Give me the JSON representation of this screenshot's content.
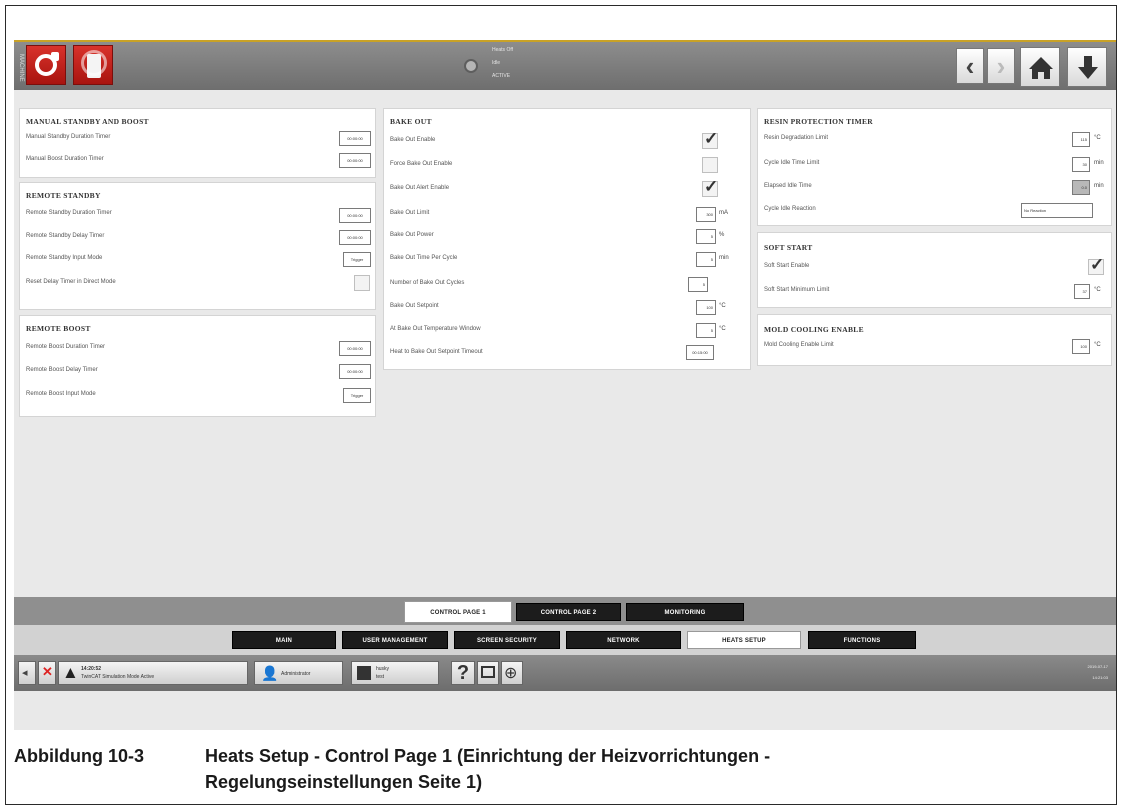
{
  "top_bar": {
    "side_tag": "MACHINE",
    "status_lines": [
      "Heats Off",
      "Idle",
      "ACTIVE"
    ],
    "prev_icon": "chevron-left-icon",
    "next_icon": "chevron-right-icon",
    "home_icon": "home-icon",
    "download_icon": "download-icon"
  },
  "manual_standby_boost": {
    "title": "MANUAL STANDBY AND BOOST",
    "rows": [
      {
        "label": "Manual Standby Duration Timer",
        "value": "00:00:00"
      },
      {
        "label": "Manual Boost Duration Timer",
        "value": "00:00:00"
      }
    ]
  },
  "remote_standby": {
    "title": "REMOTE STANDBY",
    "rows": [
      {
        "label": "Remote Standby Duration Timer",
        "value": "00:00:00"
      },
      {
        "label": "Remote Standby Delay Timer",
        "value": "00:00:00"
      },
      {
        "label": "Remote Standby Input Mode",
        "value": "Trigger"
      },
      {
        "label": "Reset Delay Timer in Direct Mode",
        "checked": false
      }
    ]
  },
  "remote_boost": {
    "title": "REMOTE BOOST",
    "rows": [
      {
        "label": "Remote Boost Duration Timer",
        "value": "00:00:00"
      },
      {
        "label": "Remote Boost Delay Timer",
        "value": "00:00:00"
      },
      {
        "label": "Remote Boost Input Mode",
        "value": "Trigger"
      }
    ]
  },
  "bake_out": {
    "title": "BAKE OUT",
    "rows": [
      {
        "label": "Bake Out Enable",
        "checked": true
      },
      {
        "label": "Force Bake Out Enable",
        "checked": false
      },
      {
        "label": "Bake Out Alert Enable",
        "checked": true
      },
      {
        "label": "Bake Out Limit",
        "value": "300",
        "unit": "mA"
      },
      {
        "label": "Bake Out Power",
        "value": "5",
        "unit": "%"
      },
      {
        "label": "Bake Out Time Per Cycle",
        "value": "5",
        "unit": "min"
      },
      {
        "label": "Number of Bake Out Cycles",
        "value": "5",
        "unit": ""
      },
      {
        "label": "Bake Out Setpoint",
        "value": "100",
        "unit": "°C"
      },
      {
        "label": "At Bake Out Temperature Window",
        "value": "5",
        "unit": "°C"
      },
      {
        "label": "Heat to Bake Out Setpoint Timeout",
        "value": "00:15:00",
        "unit": ""
      }
    ]
  },
  "resin_protection": {
    "title": "RESIN PROTECTION TIMER",
    "rows": [
      {
        "label": "Resin Degradation Limit",
        "value": "115",
        "unit": "°C"
      },
      {
        "label": "Cycle Idle Time Limit",
        "value": "30",
        "unit": "min"
      },
      {
        "label": "Elapsed Idle Time",
        "value": "0.0",
        "unit": "min"
      },
      {
        "label": "Cycle Idle Reaction",
        "value": "No Reaction",
        "unit": ""
      }
    ]
  },
  "soft_start": {
    "title": "SOFT START",
    "rows": [
      {
        "label": "Soft Start Enable",
        "checked": true
      },
      {
        "label": "Soft Start Minimum Limit",
        "value": "37",
        "unit": "°C"
      }
    ]
  },
  "mold_cooling": {
    "title": "MOLD COOLING ENABLE",
    "rows": [
      {
        "label": "Mold Cooling Enable Limit",
        "value": "100",
        "unit": "°C"
      }
    ]
  },
  "sub_tabs": [
    "CONTROL PAGE 1",
    "CONTROL PAGE 2",
    "MONITORING"
  ],
  "main_tabs": [
    "MAIN",
    "USER MANAGEMENT",
    "SCREEN SECURITY",
    "NETWORK",
    "HEATS SETUP",
    "FUNCTIONS"
  ],
  "status_bar": {
    "alarm_time": "14:20:52",
    "alarm_text": "TwinCAT Simulation Mode Active",
    "user_text": "Administrator",
    "mold_name": "husky",
    "mold_sub": "test",
    "help_glyph": "?",
    "date": "2019-07-17",
    "time": "14:21:03"
  },
  "caption": {
    "number": "Abbildung 10-3",
    "line1": "Heats Setup - Control Page 1 (Einrichtung der Heizvorrichtungen -",
    "line2": "Regelungseinstellungen Seite 1)"
  }
}
